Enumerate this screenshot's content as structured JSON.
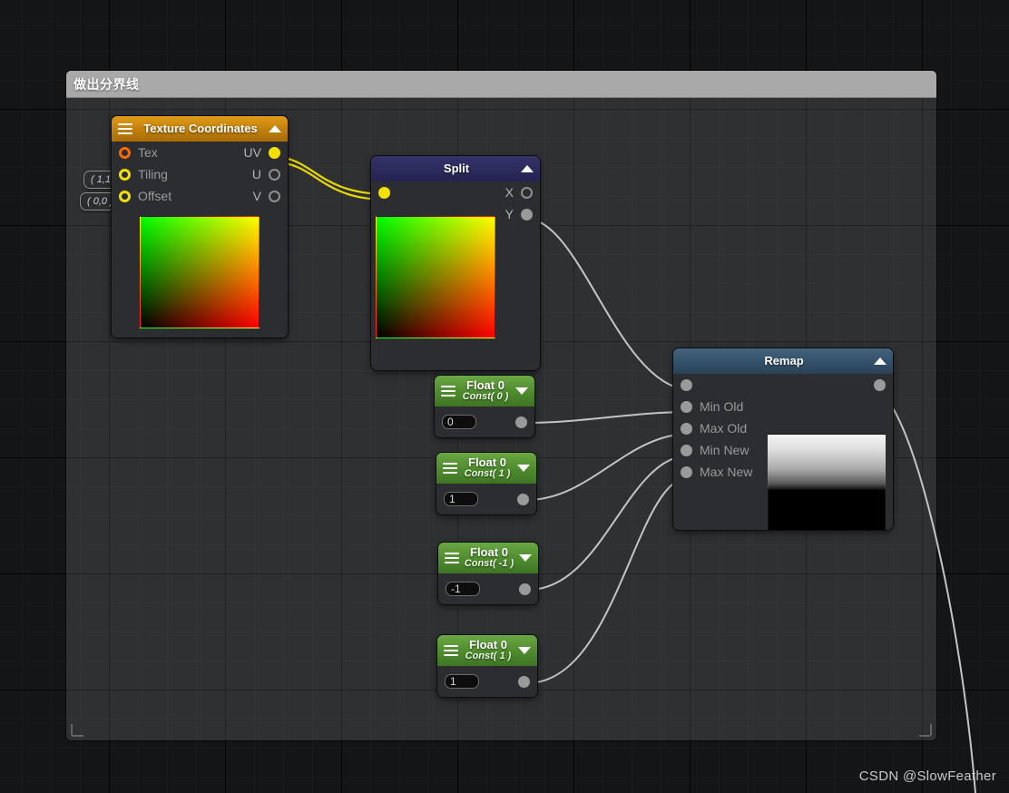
{
  "app": {
    "watermark": "CSDN @SlowFeather"
  },
  "comment": {
    "title": "做出分界线"
  },
  "chips": [
    {
      "label": "( 1,1 )"
    },
    {
      "label": "( 0,0 )"
    }
  ],
  "nodes": {
    "texture_coordinates": {
      "title": "Texture Coordinates",
      "menu_icon": "hamburger-icon",
      "collapse_icon": "caret-up-icon",
      "inputs": [
        {
          "label": "Tex",
          "pin": "ring-orange"
        },
        {
          "label": "Tiling",
          "pin": "ring-yellow"
        },
        {
          "label": "Offset",
          "pin": "ring-yellow"
        }
      ],
      "outputs": [
        {
          "label": "UV",
          "pin": "solid-yellow"
        },
        {
          "label": "U",
          "pin": "ring-gray"
        },
        {
          "label": "V",
          "pin": "ring-gray"
        }
      ],
      "preview": "uv-gradient"
    },
    "split": {
      "title": "Split",
      "collapse_icon": "caret-up-icon",
      "inputs": [
        {
          "label": "",
          "pin": "solid-yellow"
        }
      ],
      "outputs": [
        {
          "label": "X",
          "pin": "ring-gray"
        },
        {
          "label": "Y",
          "pin": "solid-gray"
        }
      ],
      "preview": "uv-gradient"
    },
    "floats": [
      {
        "title": "Float 0",
        "subtitle": "Const( 0 )",
        "value": "0",
        "menu_icon": "hamburger-icon",
        "collapse_icon": "caret-down-icon",
        "output_pin": "solid-gray"
      },
      {
        "title": "Float 0",
        "subtitle": "Const( 1 )",
        "value": "1",
        "menu_icon": "hamburger-icon",
        "collapse_icon": "caret-down-icon",
        "output_pin": "solid-gray"
      },
      {
        "title": "Float 0",
        "subtitle": "Const( -1 )",
        "value": "-1",
        "menu_icon": "hamburger-icon",
        "collapse_icon": "caret-down-icon",
        "output_pin": "solid-gray"
      },
      {
        "title": "Float 0",
        "subtitle": "Const( 1 )",
        "value": "1",
        "menu_icon": "hamburger-icon",
        "collapse_icon": "caret-down-icon",
        "output_pin": "solid-gray"
      }
    ],
    "remap": {
      "title": "Remap",
      "collapse_icon": "caret-up-icon",
      "inputs": [
        {
          "label": "",
          "pin": "solid-gray"
        },
        {
          "label": "Min Old",
          "pin": "solid-gray"
        },
        {
          "label": "Max Old",
          "pin": "solid-gray"
        },
        {
          "label": "Min New",
          "pin": "solid-gray"
        },
        {
          "label": "Max New",
          "pin": "solid-gray"
        }
      ],
      "outputs": [
        {
          "label": "",
          "pin": "solid-gray"
        }
      ],
      "preview": "black-white-gradient"
    }
  },
  "colors": {
    "canvas_bg": "#141517",
    "node_bg": "#2b2d31",
    "texcoord_header": "#c07f0c",
    "split_header": "#2a2a5a",
    "float_header": "#4d8b2e",
    "remap_header": "#33506a",
    "wire_data": "#f2e007",
    "wire_default": "#c8c8c8",
    "comment_header": "#a9a9a9"
  }
}
